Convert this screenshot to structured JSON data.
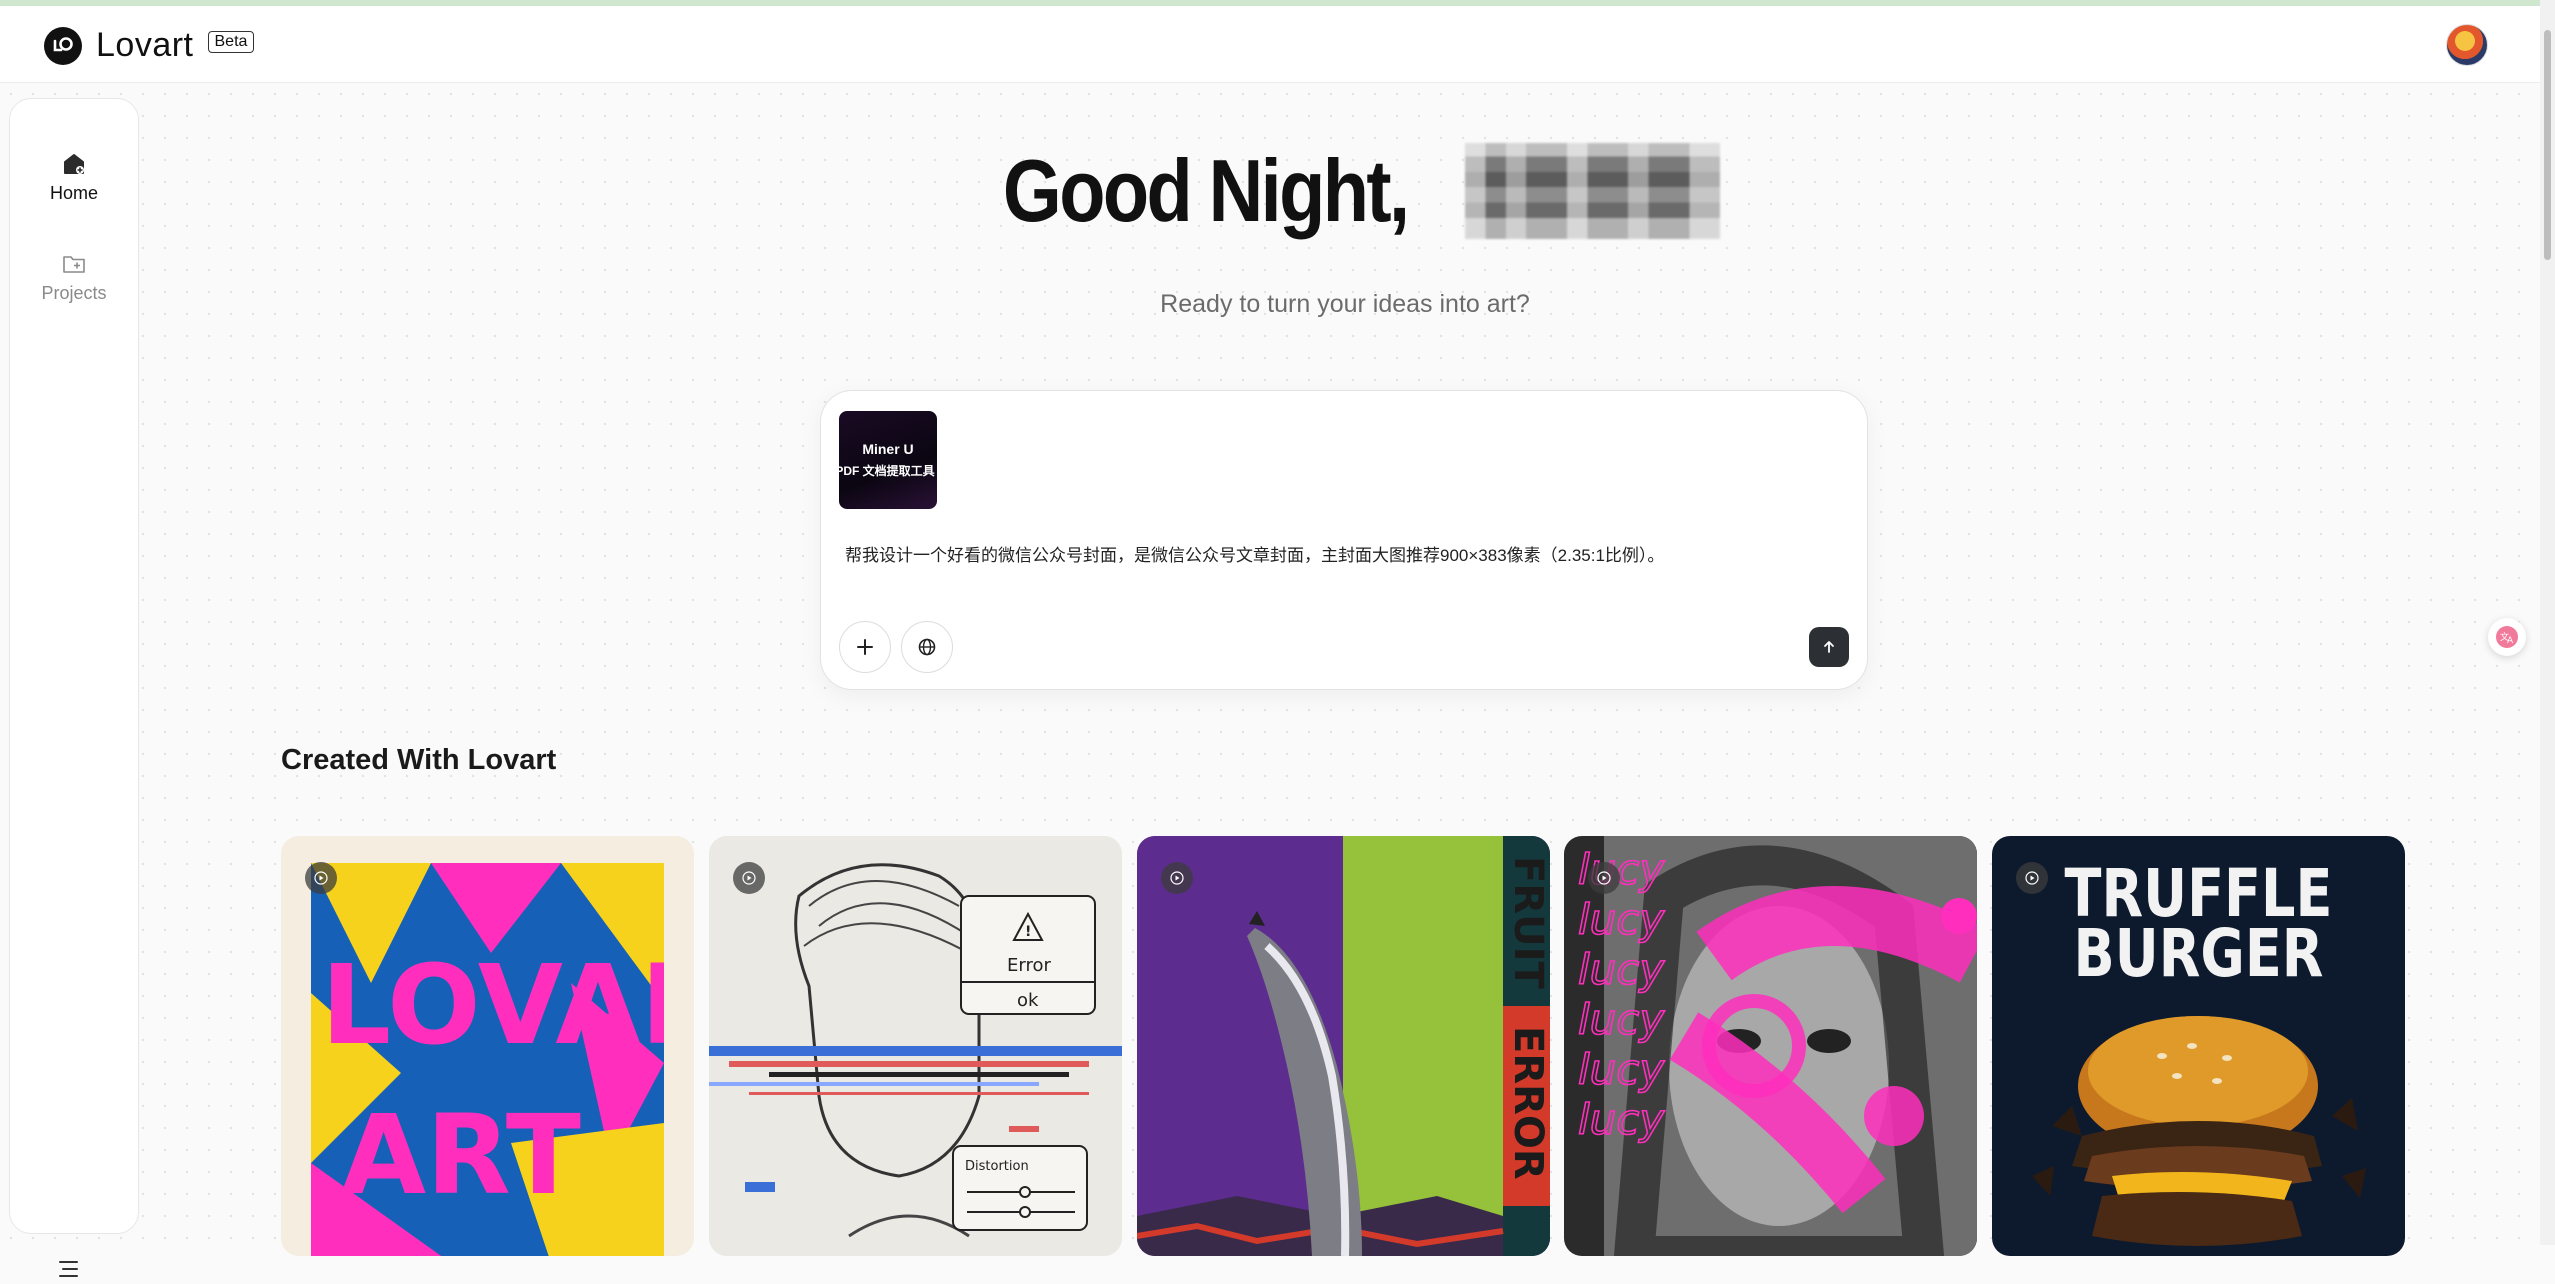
{
  "app": {
    "name": "Lovart",
    "badge": "Beta"
  },
  "sidebar": {
    "items": [
      {
        "label": "Home",
        "icon": "home-icon",
        "active": true
      },
      {
        "label": "Projects",
        "icon": "folder-add-icon",
        "active": false
      }
    ],
    "menu_icon": "menu-icon"
  },
  "greeting": {
    "text": "Good Night,"
  },
  "subtitle": "Ready to turn your ideas into art?",
  "prompt": {
    "attachment": {
      "line1": "Miner U",
      "line2": "PDF 文档提取工具"
    },
    "text": "帮我设计一个好看的微信公众号封面，是微信公众号文章封面，主封面大图推荐900×383像素（2.35:1比例）。",
    "buttons": {
      "add_icon": "plus-icon",
      "web_icon": "globe-icon",
      "send_icon": "arrow-up-icon"
    }
  },
  "gallery": {
    "title": "Created With Lovart",
    "cards": [
      {
        "name": "lovart-poster",
        "text": "LOVART"
      },
      {
        "name": "glitch-portrait",
        "error_label": "Error",
        "ok_label": "ok",
        "slider_label": "Distortion"
      },
      {
        "name": "chrome-banana",
        "side_text_1": "FRUIT",
        "side_text_2": "ERROR"
      },
      {
        "name": "lucy-portrait",
        "repeat_text": "lucy"
      },
      {
        "name": "truffle-burger",
        "title_line1": "TRUFFLE",
        "title_line2": "BURGER"
      }
    ]
  },
  "colors": {
    "accent_dark": "#2c2f33",
    "background": "#fafafa",
    "pink": "#ff2ebd"
  }
}
